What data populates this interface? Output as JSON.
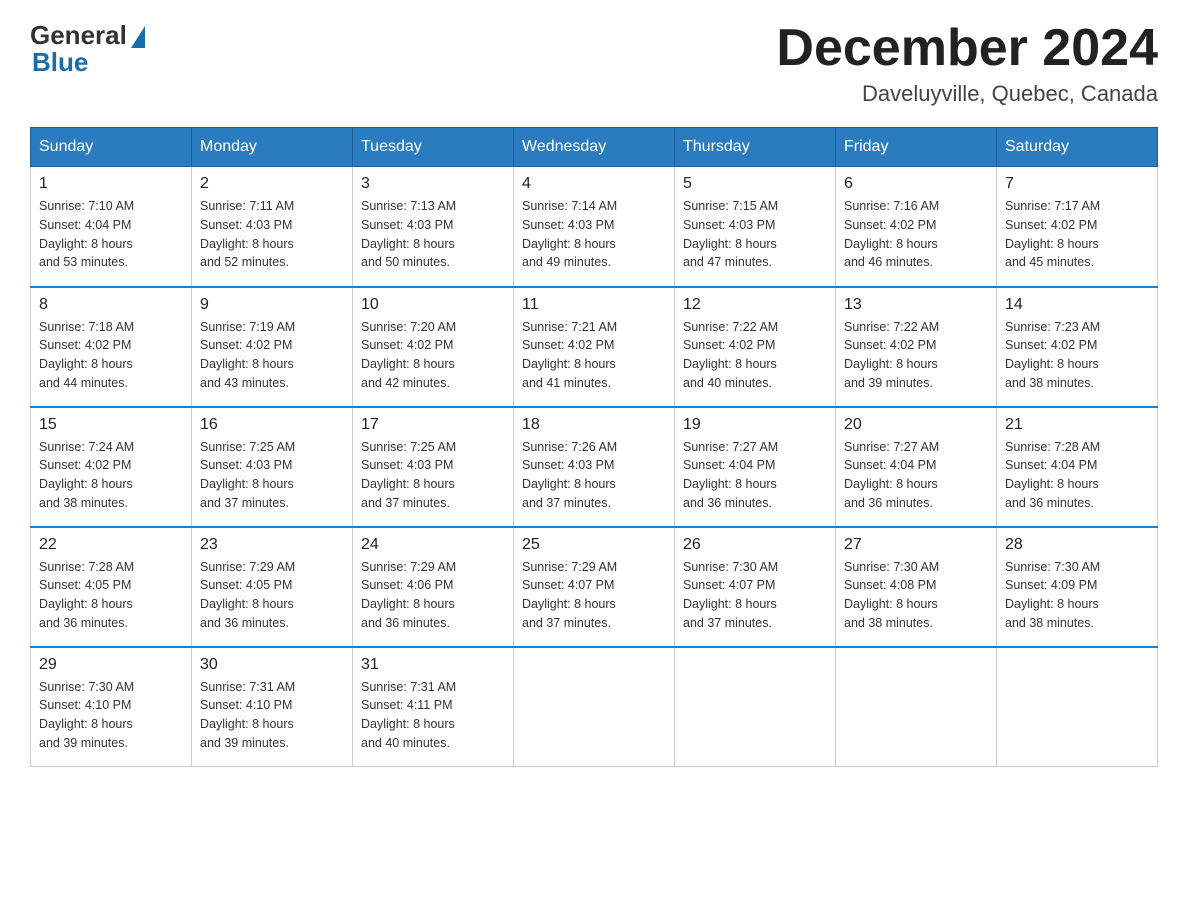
{
  "logo": {
    "general": "General",
    "blue": "Blue"
  },
  "header": {
    "month_year": "December 2024",
    "location": "Daveluyville, Quebec, Canada"
  },
  "days_of_week": [
    "Sunday",
    "Monday",
    "Tuesday",
    "Wednesday",
    "Thursday",
    "Friday",
    "Saturday"
  ],
  "weeks": [
    [
      {
        "day": "1",
        "sunrise": "7:10 AM",
        "sunset": "4:04 PM",
        "daylight": "8 hours and 53 minutes."
      },
      {
        "day": "2",
        "sunrise": "7:11 AM",
        "sunset": "4:03 PM",
        "daylight": "8 hours and 52 minutes."
      },
      {
        "day": "3",
        "sunrise": "7:13 AM",
        "sunset": "4:03 PM",
        "daylight": "8 hours and 50 minutes."
      },
      {
        "day": "4",
        "sunrise": "7:14 AM",
        "sunset": "4:03 PM",
        "daylight": "8 hours and 49 minutes."
      },
      {
        "day": "5",
        "sunrise": "7:15 AM",
        "sunset": "4:03 PM",
        "daylight": "8 hours and 47 minutes."
      },
      {
        "day": "6",
        "sunrise": "7:16 AM",
        "sunset": "4:02 PM",
        "daylight": "8 hours and 46 minutes."
      },
      {
        "day": "7",
        "sunrise": "7:17 AM",
        "sunset": "4:02 PM",
        "daylight": "8 hours and 45 minutes."
      }
    ],
    [
      {
        "day": "8",
        "sunrise": "7:18 AM",
        "sunset": "4:02 PM",
        "daylight": "8 hours and 44 minutes."
      },
      {
        "day": "9",
        "sunrise": "7:19 AM",
        "sunset": "4:02 PM",
        "daylight": "8 hours and 43 minutes."
      },
      {
        "day": "10",
        "sunrise": "7:20 AM",
        "sunset": "4:02 PM",
        "daylight": "8 hours and 42 minutes."
      },
      {
        "day": "11",
        "sunrise": "7:21 AM",
        "sunset": "4:02 PM",
        "daylight": "8 hours and 41 minutes."
      },
      {
        "day": "12",
        "sunrise": "7:22 AM",
        "sunset": "4:02 PM",
        "daylight": "8 hours and 40 minutes."
      },
      {
        "day": "13",
        "sunrise": "7:22 AM",
        "sunset": "4:02 PM",
        "daylight": "8 hours and 39 minutes."
      },
      {
        "day": "14",
        "sunrise": "7:23 AM",
        "sunset": "4:02 PM",
        "daylight": "8 hours and 38 minutes."
      }
    ],
    [
      {
        "day": "15",
        "sunrise": "7:24 AM",
        "sunset": "4:02 PM",
        "daylight": "8 hours and 38 minutes."
      },
      {
        "day": "16",
        "sunrise": "7:25 AM",
        "sunset": "4:03 PM",
        "daylight": "8 hours and 37 minutes."
      },
      {
        "day": "17",
        "sunrise": "7:25 AM",
        "sunset": "4:03 PM",
        "daylight": "8 hours and 37 minutes."
      },
      {
        "day": "18",
        "sunrise": "7:26 AM",
        "sunset": "4:03 PM",
        "daylight": "8 hours and 37 minutes."
      },
      {
        "day": "19",
        "sunrise": "7:27 AM",
        "sunset": "4:04 PM",
        "daylight": "8 hours and 36 minutes."
      },
      {
        "day": "20",
        "sunrise": "7:27 AM",
        "sunset": "4:04 PM",
        "daylight": "8 hours and 36 minutes."
      },
      {
        "day": "21",
        "sunrise": "7:28 AM",
        "sunset": "4:04 PM",
        "daylight": "8 hours and 36 minutes."
      }
    ],
    [
      {
        "day": "22",
        "sunrise": "7:28 AM",
        "sunset": "4:05 PM",
        "daylight": "8 hours and 36 minutes."
      },
      {
        "day": "23",
        "sunrise": "7:29 AM",
        "sunset": "4:05 PM",
        "daylight": "8 hours and 36 minutes."
      },
      {
        "day": "24",
        "sunrise": "7:29 AM",
        "sunset": "4:06 PM",
        "daylight": "8 hours and 36 minutes."
      },
      {
        "day": "25",
        "sunrise": "7:29 AM",
        "sunset": "4:07 PM",
        "daylight": "8 hours and 37 minutes."
      },
      {
        "day": "26",
        "sunrise": "7:30 AM",
        "sunset": "4:07 PM",
        "daylight": "8 hours and 37 minutes."
      },
      {
        "day": "27",
        "sunrise": "7:30 AM",
        "sunset": "4:08 PM",
        "daylight": "8 hours and 38 minutes."
      },
      {
        "day": "28",
        "sunrise": "7:30 AM",
        "sunset": "4:09 PM",
        "daylight": "8 hours and 38 minutes."
      }
    ],
    [
      {
        "day": "29",
        "sunrise": "7:30 AM",
        "sunset": "4:10 PM",
        "daylight": "8 hours and 39 minutes."
      },
      {
        "day": "30",
        "sunrise": "7:31 AM",
        "sunset": "4:10 PM",
        "daylight": "8 hours and 39 minutes."
      },
      {
        "day": "31",
        "sunrise": "7:31 AM",
        "sunset": "4:11 PM",
        "daylight": "8 hours and 40 minutes."
      },
      null,
      null,
      null,
      null
    ]
  ],
  "labels": {
    "sunrise": "Sunrise:",
    "sunset": "Sunset:",
    "daylight": "Daylight:"
  }
}
